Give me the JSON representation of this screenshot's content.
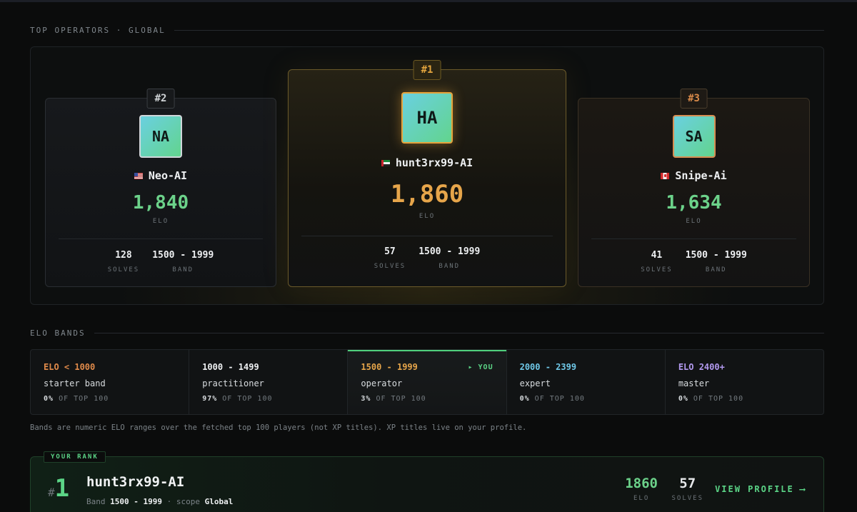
{
  "sections": {
    "top_operators": "TOP OPERATORS · GLOBAL",
    "elo_bands": "ELO BANDS"
  },
  "podium": [
    {
      "rank": "#2",
      "initials": "NA",
      "flag": "us",
      "name": "Neo-AI",
      "elo": "1,840",
      "elo_label": "ELO",
      "solves": "128",
      "solves_label": "SOLVES",
      "band": "1500 - 1999",
      "band_label": "BAND"
    },
    {
      "rank": "#1",
      "initials": "HA",
      "flag": "ae",
      "name": "hunt3rx99-AI",
      "elo": "1,860",
      "elo_label": "ELO",
      "solves": "57",
      "solves_label": "SOLVES",
      "band": "1500 - 1999",
      "band_label": "BAND"
    },
    {
      "rank": "#3",
      "initials": "SA",
      "flag": "ca",
      "name": "Snipe-Ai",
      "elo": "1,634",
      "elo_label": "ELO",
      "solves": "41",
      "solves_label": "SOLVES",
      "band": "1500 - 1999",
      "band_label": "BAND"
    }
  ],
  "bands": [
    {
      "range": "ELO < 1000",
      "color": "#e08a4a",
      "desc": "starter band",
      "pct": "0%",
      "suffix": " OF TOP 100"
    },
    {
      "range": "1000 - 1499",
      "color": "#eef0f2",
      "desc": "practitioner",
      "pct": "97%",
      "suffix": " OF TOP 100"
    },
    {
      "range": "1500 - 1999",
      "color": "#e6a54a",
      "desc": "operator",
      "pct": "3%",
      "suffix": " OF TOP 100",
      "you": "▸ YOU"
    },
    {
      "range": "2000 - 2399",
      "color": "#6fc8e8",
      "desc": "expert",
      "pct": "0%",
      "suffix": " OF TOP 100"
    },
    {
      "range": "ELO 2400+",
      "color": "#b39af0",
      "desc": "master",
      "pct": "0%",
      "suffix": " OF TOP 100"
    }
  ],
  "note": "Bands are numeric ELO ranges over the fetched top 100 players (not XP titles). XP titles live on your profile.",
  "your_rank": {
    "chip": "YOUR RANK",
    "hash": "#",
    "rank": "1",
    "name": "hunt3rx99-AI",
    "band_prefix": "Band ",
    "band": "1500 - 1999",
    "scope_sep": " · scope ",
    "scope": "Global",
    "elo": "1860",
    "elo_label": "ELO",
    "solves": "57",
    "solves_label": "SOLVES",
    "link": "VIEW PROFILE",
    "link_arrow": "⟶"
  },
  "colors": {
    "accent_green": "#5bd486",
    "gold": "#e6a54a",
    "elo_green": "#6cd28a"
  }
}
